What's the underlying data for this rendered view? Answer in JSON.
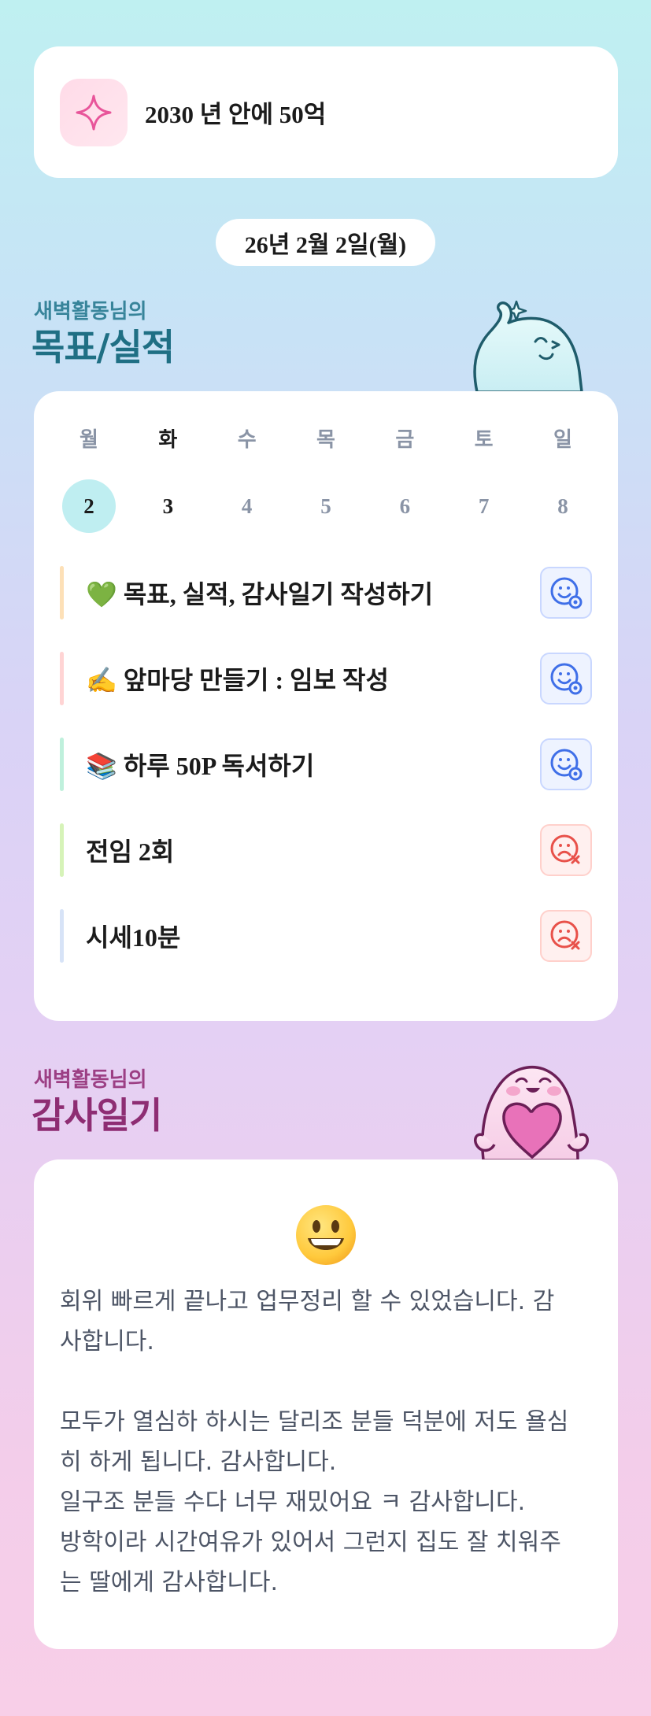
{
  "goal": {
    "icon": "sparkle-icon",
    "text": "2030 년 안에 50억"
  },
  "date": "26년 2월 2일(월)",
  "goals_section": {
    "subtitle": "새벽활동님의",
    "title": "목표/실적"
  },
  "calendar": {
    "days": [
      {
        "dow": "월",
        "num": "2",
        "selected": true
      },
      {
        "dow": "화",
        "num": "3",
        "today": true
      },
      {
        "dow": "수",
        "num": "4"
      },
      {
        "dow": "목",
        "num": "5"
      },
      {
        "dow": "금",
        "num": "6"
      },
      {
        "dow": "토",
        "num": "7"
      },
      {
        "dow": "일",
        "num": "8"
      }
    ]
  },
  "tasks": [
    {
      "label": "💚 목표, 실적, 감사일기 작성하기",
      "bar_color": "#fde0b7",
      "status": "done"
    },
    {
      "label": "✍️ 앞마당 만들기 : 임보 작성",
      "bar_color": "#ffd4d4",
      "status": "done"
    },
    {
      "label": "📚 하루 50P 독서하기",
      "bar_color": "#bff0dc",
      "status": "done"
    },
    {
      "label": "전임 2회",
      "bar_color": "#d6f3b8",
      "status": "fail"
    },
    {
      "label": "시세10분",
      "bar_color": "#d7e3f7",
      "status": "fail"
    }
  ],
  "diary_section": {
    "subtitle": "새벽활동님의",
    "title": "감사일기"
  },
  "diary": {
    "emoji": "grinning-face",
    "text": "회위 빠르게 끝나고 업무정리 할 수 있었습니다. 감\n사합니다.\n\n모두가 열심하 하시는 달리조 분들 덕분에 저도 욜심\n히 하게 됩니다. 감사합니다.\n일구조 분들 수다 너무 재밌어요 ㅋ 감사합니다.\n방학이라 시간여유가 있어서 그런지 집도 잘 치워주\n는 딸에게 감사합니다."
  },
  "colors": {
    "selected_day": "#bfeef1",
    "done": "#3f6fe8",
    "fail": "#e8514a"
  }
}
